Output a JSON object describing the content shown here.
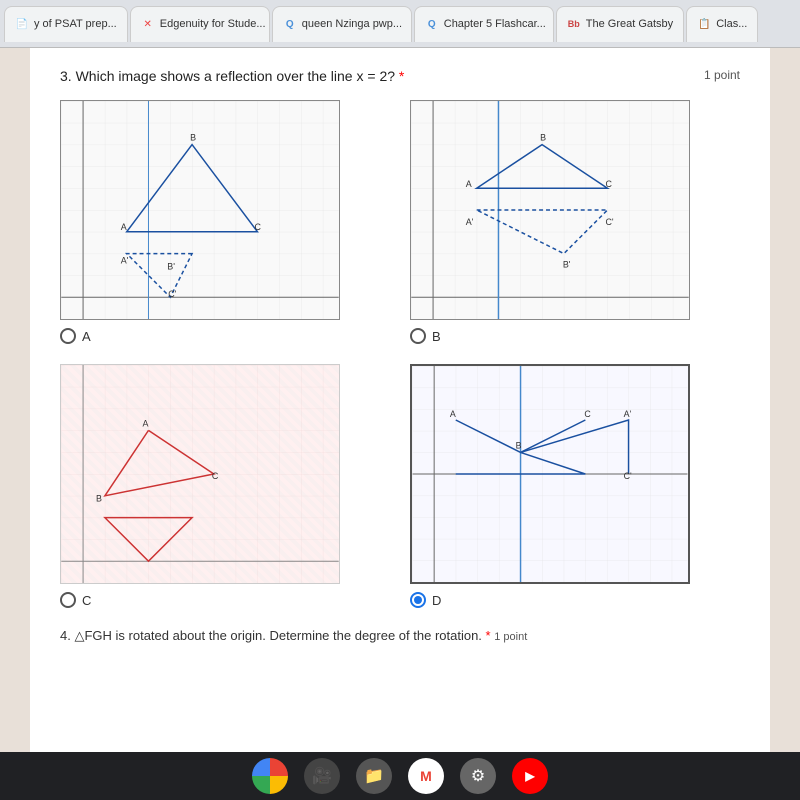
{
  "tabs": [
    {
      "id": "tab1",
      "label": "y of PSAT prep...",
      "favicon": "📄",
      "active": false
    },
    {
      "id": "tab2",
      "label": "Edgenuity for Stude...",
      "favicon": "✕",
      "active": false
    },
    {
      "id": "tab3",
      "label": "queen Nzinga pwp...",
      "favicon": "Q",
      "active": false
    },
    {
      "id": "tab4",
      "label": "Chapter 5 Flashcar...",
      "favicon": "Q",
      "active": false
    },
    {
      "id": "tab5",
      "label": "The Great Gatsby",
      "favicon": "Bb",
      "active": false
    },
    {
      "id": "tab6",
      "label": "Clas...",
      "favicon": "📋",
      "active": false
    }
  ],
  "question3": {
    "number": "3.",
    "text": "Which image shows a reflection over the line x = 2?",
    "required": "*",
    "points": "1 point"
  },
  "options": [
    {
      "id": "A",
      "label": "A",
      "selected": false
    },
    {
      "id": "B",
      "label": "B",
      "selected": false
    },
    {
      "id": "C",
      "label": "C",
      "selected": false
    },
    {
      "id": "D",
      "label": "D",
      "selected": true
    }
  ],
  "question4": {
    "number": "4.",
    "text": "△FGH is rotated about the origin. Determine the degree of the rotation.",
    "required": "*",
    "points": "1 point"
  },
  "taskbar": {
    "icons": [
      "chrome",
      "camera",
      "files",
      "gmail",
      "settings",
      "youtube"
    ]
  }
}
